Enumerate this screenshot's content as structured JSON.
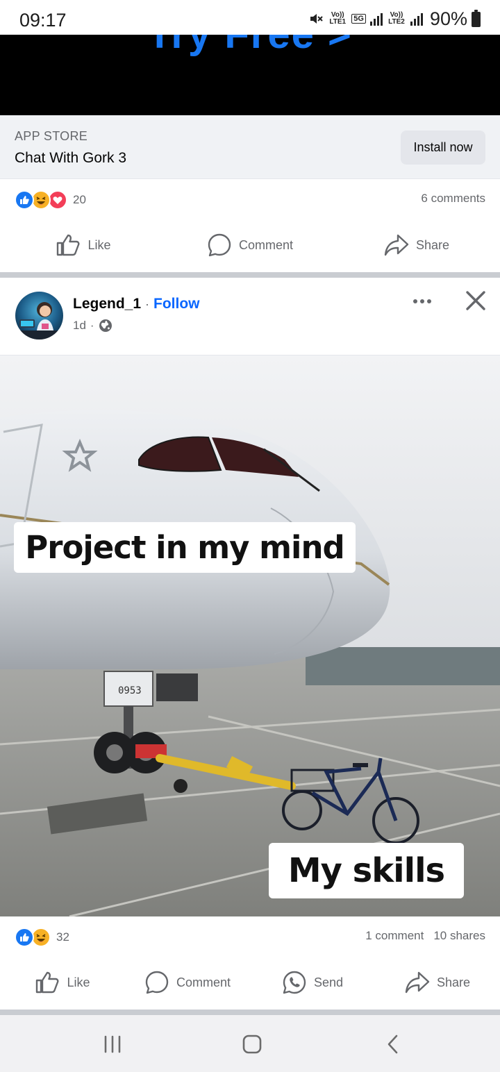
{
  "status_bar": {
    "time": "09:17",
    "sim1_label": "Vo)) LTE1",
    "network_type": "5G",
    "sim2_label": "Vo)) LTE2",
    "battery": "90%"
  },
  "ad": {
    "media_text": "Try Free >",
    "store_label": "APP STORE",
    "app_name": "Chat With Gork 3",
    "install_label": "Install now",
    "reaction_count": "20",
    "comments": "6 comments",
    "actions": {
      "like": "Like",
      "comment": "Comment",
      "share": "Share"
    }
  },
  "post": {
    "author": "Legend_1",
    "separator": "·",
    "follow_label": "Follow",
    "time": "1d",
    "audience_icon": "globe-icon",
    "image": {
      "caption_top": "Project in my mind",
      "caption_bottom": "My skills"
    },
    "reaction_count": "32",
    "comments": "1 comment",
    "shares": "10 shares",
    "actions": {
      "like": "Like",
      "comment": "Comment",
      "send": "Send",
      "share": "Share"
    }
  },
  "colors": {
    "brand_blue": "#0866ff",
    "like_blue": "#1877f2",
    "haha_yellow": "#f7b125",
    "love_red": "#f33e58",
    "secondary_text": "#65676b"
  }
}
